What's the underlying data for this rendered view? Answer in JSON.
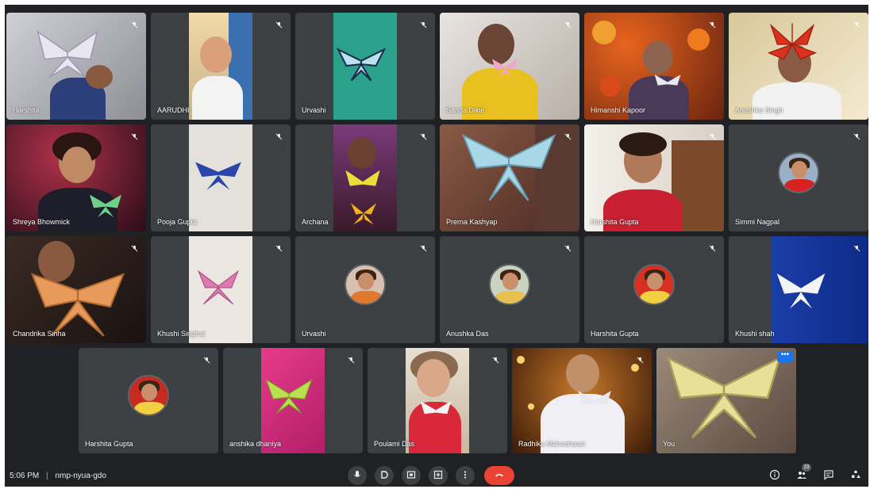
{
  "colors": {
    "meet_bg": "#202124",
    "tile_bg": "#3c4043",
    "end_call": "#ea4335",
    "accent": "#8ab4f8"
  },
  "participants": [
    {
      "name": "Harshita",
      "muted": true,
      "view": "video"
    },
    {
      "name": "AARUDHI",
      "muted": true,
      "view": "video"
    },
    {
      "name": "Urvashi",
      "muted": true,
      "view": "video"
    },
    {
      "name": "Sanda Dikie",
      "muted": true,
      "view": "video"
    },
    {
      "name": "Himanshi Kapoor",
      "muted": true,
      "view": "video"
    },
    {
      "name": "Anushka Singh",
      "muted": true,
      "view": "video"
    },
    {
      "name": "Shreya Bhowmick",
      "muted": true,
      "view": "video"
    },
    {
      "name": "Pooja Gupta",
      "muted": true,
      "view": "video"
    },
    {
      "name": "Archana",
      "muted": true,
      "view": "video"
    },
    {
      "name": "Prerna Kashyap",
      "muted": true,
      "view": "video"
    },
    {
      "name": "Harshita Gupta",
      "muted": true,
      "view": "video"
    },
    {
      "name": "Simmi Nagpal",
      "muted": true,
      "view": "avatar"
    },
    {
      "name": "Chandrika Sinha",
      "muted": true,
      "view": "video"
    },
    {
      "name": "Khushi Singhal",
      "muted": true,
      "view": "video"
    },
    {
      "name": "Urvashi",
      "muted": true,
      "view": "avatar"
    },
    {
      "name": "Anushka Das",
      "muted": true,
      "view": "avatar"
    },
    {
      "name": "Harshita Gupta",
      "muted": true,
      "view": "avatar"
    },
    {
      "name": "Khushi shah",
      "muted": true,
      "view": "video"
    },
    {
      "name": "Harshita Gupta",
      "muted": true,
      "view": "avatar"
    },
    {
      "name": "anshika dhaniya",
      "muted": true,
      "view": "video"
    },
    {
      "name": "Poulami Das",
      "muted": true,
      "view": "video"
    },
    {
      "name": "Radhika Maheshwari",
      "muted": true,
      "view": "video"
    },
    {
      "name": "You",
      "muted": false,
      "view": "video",
      "self": true
    }
  ],
  "bottom_bar": {
    "time": "5:06 PM",
    "separator": "|",
    "meeting_code": "nmp-nyua-gdo",
    "participant_count": "23"
  },
  "icons": {
    "mic": "mic-icon",
    "mic_off": "mic-off-icon",
    "captions": "captions-icon",
    "present": "present-icon",
    "raise_hand": "raise-hand-icon",
    "more": "more-options-icon",
    "end_call": "end-call-icon",
    "info": "info-icon",
    "people": "people-icon",
    "chat": "chat-icon",
    "activities": "activities-icon"
  }
}
